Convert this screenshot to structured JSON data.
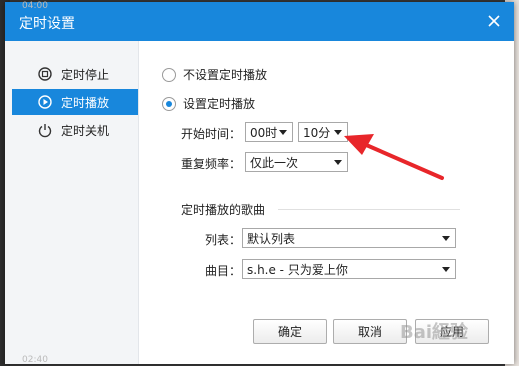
{
  "background": {
    "time_top": "04:00",
    "time_bottom": "02:40"
  },
  "dialog": {
    "title": "定时设置",
    "close_icon": "close-icon"
  },
  "sidebar": {
    "items": [
      {
        "label": "定时停止",
        "icon": "timer-stop-icon",
        "active": false
      },
      {
        "label": "定时播放",
        "icon": "timer-play-icon",
        "active": true
      },
      {
        "label": "定时关机",
        "icon": "power-icon",
        "active": false
      }
    ]
  },
  "options": {
    "no_schedule_label": "不设置定时播放",
    "schedule_label": "设置定时播放",
    "selected": "schedule"
  },
  "start_time": {
    "label": "开始时间：",
    "hour": "00时",
    "minute": "10分"
  },
  "repeat": {
    "label": "重复频率：",
    "value": "仅此一次"
  },
  "songs": {
    "group_title": "定时播放的歌曲",
    "list_label": "列表：",
    "list_value": "默认列表",
    "track_label": "曲目：",
    "track_value": "s.h.e - 只为爱上你"
  },
  "buttons": {
    "ok": "确定",
    "cancel": "取消",
    "apply": "应用"
  },
  "annotation": {
    "arrow_color": "#e8262a"
  },
  "watermark": {
    "text": "Bai経验"
  },
  "colors": {
    "accent": "#1887dc",
    "sidebar_bg": "#f3f5f7"
  }
}
